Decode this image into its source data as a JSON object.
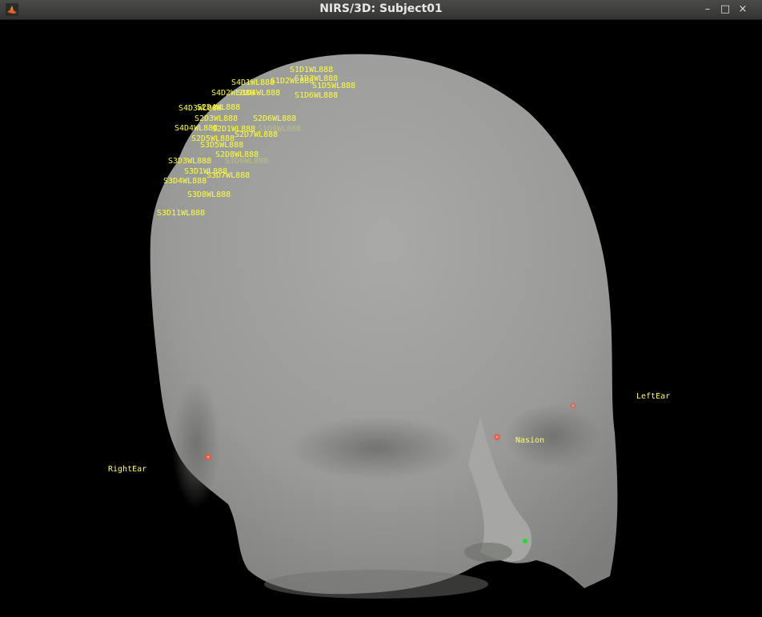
{
  "window": {
    "title": "NIRS/3D: Subject01",
    "controls": {
      "minimize": "–",
      "maximize": "□",
      "close": "×"
    }
  },
  "colors": {
    "background": "#000000",
    "head_surface": "#9d9e9b",
    "label_yellow": "#ffff33",
    "fiducial_red": "#ff4a3a",
    "marker_green": "#22dd22"
  },
  "fiducials": {
    "right_ear": "RightEar",
    "left_ear": "LeftEar",
    "nasion": "Nasion"
  },
  "channels": [
    {
      "label": "S1D1WL888"
    },
    {
      "label": "S1D3WL888"
    },
    {
      "label": "S1D5WL888"
    },
    {
      "label": "S1D2WL888"
    },
    {
      "label": "S4D1WL888"
    },
    {
      "label": "S1D6WL888"
    },
    {
      "label": "S4D2WL888"
    },
    {
      "label": "S1D4WL888"
    },
    {
      "label": "S4D3WL888"
    },
    {
      "label": "S2D4WL888"
    },
    {
      "label": "S2D3WL888"
    },
    {
      "label": "S2D6WL888"
    },
    {
      "label": "S2D1WL888"
    },
    {
      "label": "S4D4WL888"
    },
    {
      "label": "S1D8WL888"
    },
    {
      "label": "S2D7WL888"
    },
    {
      "label": "S2D5WL888"
    },
    {
      "label": "S3D5WL888"
    },
    {
      "label": "S2D8WL888"
    },
    {
      "label": "S3D6WL888"
    },
    {
      "label": "S3D3WL888"
    },
    {
      "label": "S3D1WL888"
    },
    {
      "label": "S3D7WL888"
    },
    {
      "label": "S3D4WL888"
    },
    {
      "label": "S3D8WL888"
    },
    {
      "label": "S3D11WL888"
    }
  ]
}
